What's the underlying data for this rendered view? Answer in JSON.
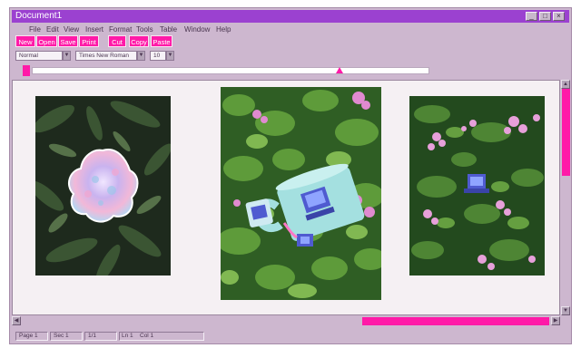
{
  "window": {
    "title": "Document1",
    "minimize": "_",
    "maximize": "□",
    "close": "×"
  },
  "menu": [
    "File",
    "Edit",
    "View",
    "Insert",
    "Format",
    "Tools",
    "Table",
    "Window",
    "Help"
  ],
  "toolbar": {
    "new": "New",
    "open": "Open",
    "save": "Save",
    "print": "Print",
    "cut": "Cut",
    "copy": "Copy",
    "paste": "Paste"
  },
  "format": {
    "style": "Normal",
    "font": "Times New Roman",
    "size": "10"
  },
  "status": {
    "page": "Page 1",
    "section": "Sec 1",
    "page_count": "1/1",
    "line": "Ln 1",
    "column": "Col 1"
  },
  "colors": {
    "title_bar": "#9b41d0",
    "accent": "#ff1aa8",
    "chrome": "#cdb7cf"
  }
}
